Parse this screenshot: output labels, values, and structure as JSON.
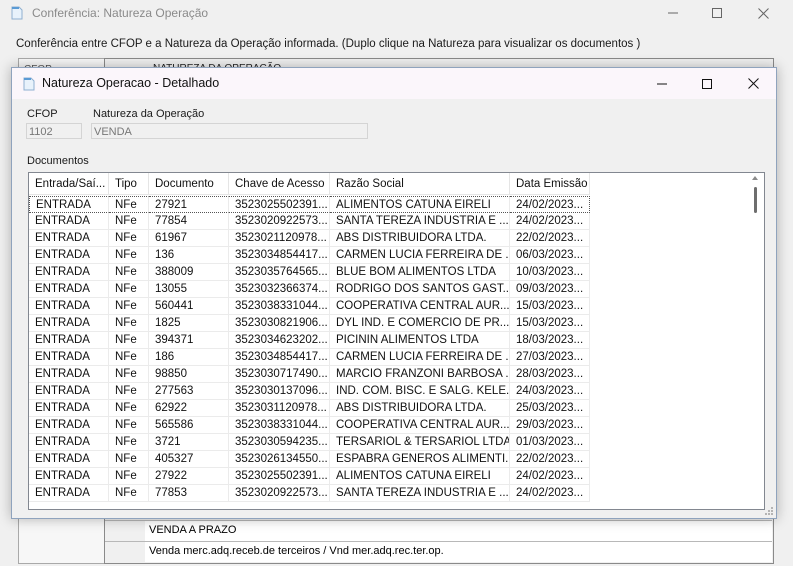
{
  "background_window": {
    "title": "Conferência: Natureza Operação",
    "description": "Conferência entre CFOP e a Natureza da Operação informada. (Duplo clique na Natureza para visualizar os documentos )",
    "cfop_header": "CFOP",
    "natureza_header": "NATUREZA DA OPERAÇÃO",
    "rows": [
      "VENDA A PRAZO",
      "Venda merc.adq.receb.de terceiros /  Vnd mer.adq.rec.ter.op."
    ]
  },
  "dialog": {
    "title": "Natureza Operacao - Detalhado",
    "cfop_label": "CFOP",
    "cfop_value": "1102",
    "natureza_label": "Natureza da Operação",
    "natureza_value": "VENDA",
    "documentos_label": "Documentos",
    "grid": {
      "columns": [
        "Entrada/Saí...",
        "Tipo",
        "Documento",
        "Chave de Acesso",
        "Razão Social",
        "Data Emissão"
      ],
      "rows": [
        [
          "ENTRADA",
          "NFe",
          "27921",
          "3523025502391...",
          "ALIMENTOS CATUNA EIRELI",
          "24/02/2023..."
        ],
        [
          "ENTRADA",
          "NFe",
          "77854",
          "3523020922573...",
          "SANTA TEREZA INDUSTRIA E ...",
          "24/02/2023..."
        ],
        [
          "ENTRADA",
          "NFe",
          "61967",
          "3523021120978...",
          "ABS DISTRIBUIDORA LTDA.",
          "22/02/2023..."
        ],
        [
          "ENTRADA",
          "NFe",
          "136",
          "3523034854417...",
          "CARMEN LUCIA FERREIRA DE ...",
          "06/03/2023..."
        ],
        [
          "ENTRADA",
          "NFe",
          "388009",
          "3523035764565...",
          "BLUE BOM ALIMENTOS LTDA",
          "10/03/2023..."
        ],
        [
          "ENTRADA",
          "NFe",
          "13055",
          "3523032366374...",
          "RODRIGO DOS SANTOS GAST...",
          "09/03/2023..."
        ],
        [
          "ENTRADA",
          "NFe",
          "560441",
          "3523038331044...",
          "COOPERATIVA CENTRAL AUR...",
          "15/03/2023..."
        ],
        [
          "ENTRADA",
          "NFe",
          "1825",
          "3523030821906...",
          "DYL IND. E COMERCIO DE PR...",
          "15/03/2023..."
        ],
        [
          "ENTRADA",
          "NFe",
          "394371",
          "3523034623202...",
          "PICININ ALIMENTOS LTDA",
          "18/03/2023..."
        ],
        [
          "ENTRADA",
          "NFe",
          "186",
          "3523034854417...",
          "CARMEN LUCIA FERREIRA DE ...",
          "27/03/2023..."
        ],
        [
          "ENTRADA",
          "NFe",
          "98850",
          "3523030717490...",
          "MARCIO FRANZONI BARBOSA ...",
          "28/03/2023..."
        ],
        [
          "ENTRADA",
          "NFe",
          "277563",
          "3523030137096...",
          "IND. COM. BISC. E SALG. KELE...",
          "24/03/2023..."
        ],
        [
          "ENTRADA",
          "NFe",
          "62922",
          "3523031120978...",
          "ABS DISTRIBUIDORA LTDA.",
          "25/03/2023..."
        ],
        [
          "ENTRADA",
          "NFe",
          "565586",
          "3523038331044...",
          "COOPERATIVA CENTRAL AUR...",
          "29/03/2023..."
        ],
        [
          "ENTRADA",
          "NFe",
          "3721",
          "3523030594235...",
          "TERSARIOL & TERSARIOL LTDA",
          "01/03/2023..."
        ],
        [
          "ENTRADA",
          "NFe",
          "405327",
          "3523026134550...",
          "ESPABRA GENEROS ALIMENTI...",
          "22/02/2023..."
        ],
        [
          "ENTRADA",
          "NFe",
          "27922",
          "3523025502391...",
          "ALIMENTOS CATUNA EIRELI",
          "24/02/2023..."
        ],
        [
          "ENTRADA",
          "NFe",
          "77853",
          "3523020922573...",
          "SANTA TEREZA INDUSTRIA E ...",
          "24/02/2023..."
        ]
      ]
    }
  },
  "icons": {
    "app": "document-icon",
    "minimize": "minimize-icon",
    "maximize": "maximize-icon",
    "close": "close-icon"
  }
}
